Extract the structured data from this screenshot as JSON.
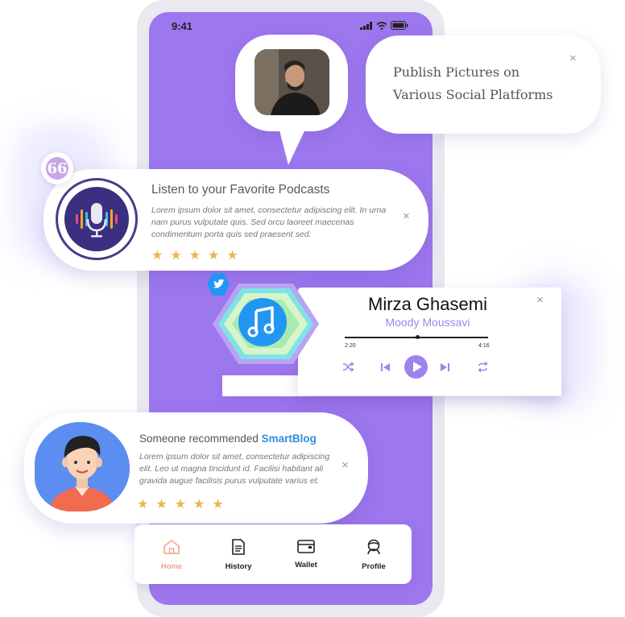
{
  "status_bar": {
    "time": "9:41"
  },
  "publish_card": {
    "text": "Publish Pictures on Various Social Platforms",
    "close": "×"
  },
  "podcast_card": {
    "quote_glyph": "66",
    "title": "Listen to your Favorite Podcasts",
    "body": "Lorem ipsum dolor sit amet, consectetur adipiscing elit. In urna nam purus vulputate quis. Sed orcu laoreet maecenas condimentum porta quis sed praesent sed.",
    "rating": 5,
    "close": "×"
  },
  "music_card": {
    "artist": "Mirza Ghasemi",
    "song": "Moody Moussavi",
    "time_elapsed": "2:20",
    "time_total": "4:16",
    "progress": 0.51,
    "close": "×"
  },
  "recommend_card": {
    "title_prefix": "Someone recommended ",
    "brand": "SmartBlog",
    "body": "Lorem ipsum dolor sit amet, consectetur adipiscing elit. Leo ut magna tincidunt id. Facilisi habitant ali gravida augue facilisis purus vulputate varius et.",
    "rating": 5,
    "close": "×"
  },
  "bottom_nav": {
    "items": [
      {
        "label": "Home",
        "icon": "home-icon",
        "active": true
      },
      {
        "label": "History",
        "icon": "history-icon",
        "active": false
      },
      {
        "label": "Wallet",
        "icon": "wallet-icon",
        "active": false
      },
      {
        "label": "Profile",
        "icon": "profile-icon",
        "active": false
      }
    ]
  },
  "colors": {
    "phone_screen": "#9d77ee",
    "accent_purple": "#9d84ea",
    "star": "#e8b84a",
    "brand_blue": "#2f8fe0",
    "active_nav": "#f0a38f"
  }
}
